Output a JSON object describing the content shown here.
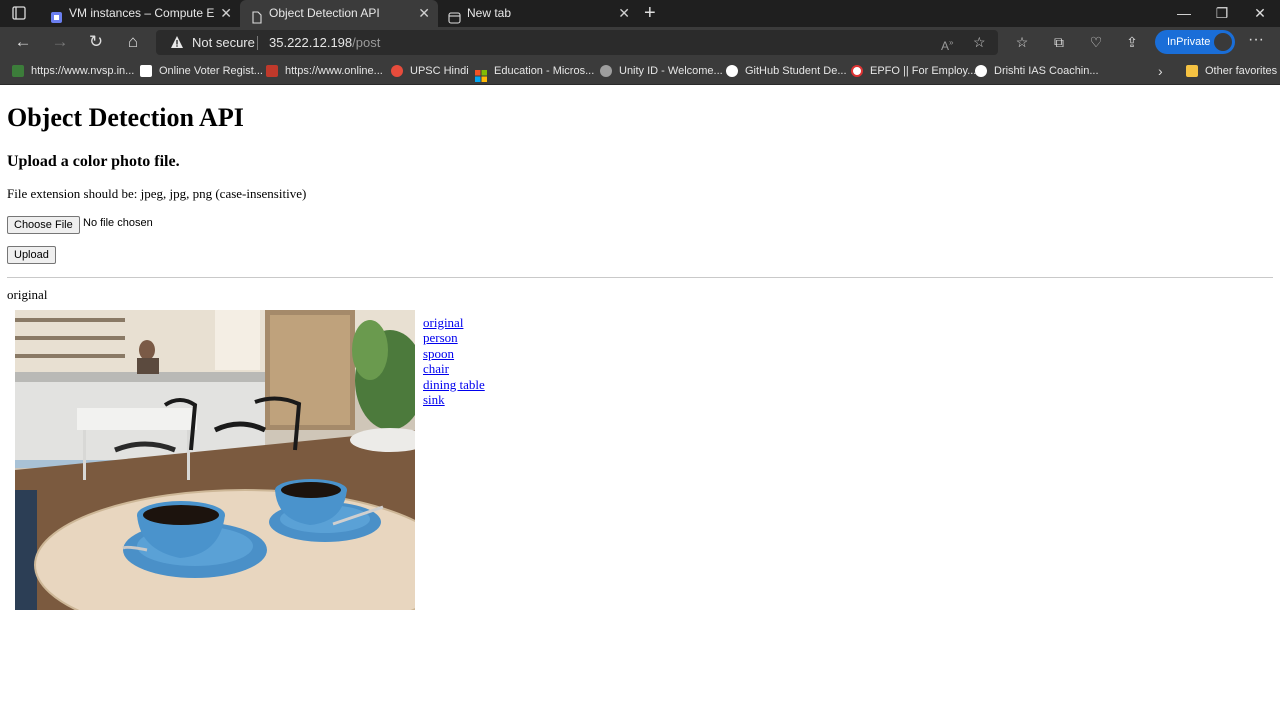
{
  "browser": {
    "tabs": [
      {
        "label": "VM instances – Compute Engine",
        "active": false
      },
      {
        "label": "Object Detection API",
        "active": true
      },
      {
        "label": "New tab",
        "active": false
      }
    ],
    "address": {
      "security": "Not secure",
      "host": "35.222.12.198",
      "path": "/post"
    },
    "profile_label": "InPrivate",
    "bookmarks": [
      {
        "label": "https://www.nvsp.in...",
        "color": "#3c7d3a"
      },
      {
        "label": "Online Voter Regist...",
        "color": "#ffffff"
      },
      {
        "label": "https://www.online...",
        "color": "#c0392b"
      },
      {
        "label": "UPSC Hindi",
        "color": "#e74c3c"
      },
      {
        "label": "Education - Micros...",
        "color": "#f35325"
      },
      {
        "label": "Unity ID - Welcome...",
        "color": "#bdbdbd"
      },
      {
        "label": "GitHub Student De...",
        "color": "#ffffff"
      },
      {
        "label": "EPFO || For Employ...",
        "color": "#d33"
      },
      {
        "label": "Drishti IAS Coachin...",
        "color": "#c0392b"
      }
    ],
    "other_favorites": "Other favorites"
  },
  "page": {
    "title": "Object Detection API",
    "subtitle": "Upload a color photo file.",
    "extension_note": "File extension should be: jpeg, jpg, png (case-insensitive)",
    "choose_file_label": "Choose File",
    "no_file_text": "No file chosen",
    "upload_label": "Upload",
    "current_view": "original",
    "detection_links": [
      "original",
      "person",
      "spoon",
      "chair",
      "dining table",
      "sink"
    ]
  }
}
